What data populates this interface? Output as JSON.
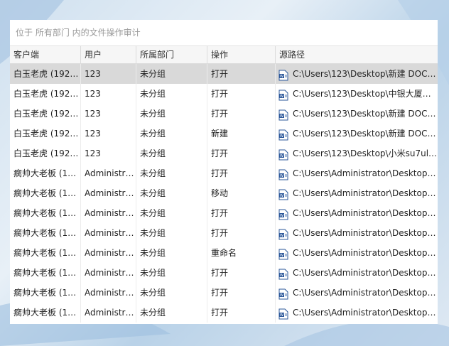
{
  "window": {
    "title": "位于 所有部门 内的文件操作审计"
  },
  "columns": [
    "客户端",
    "用户",
    "所属部门",
    "操作",
    "源路径"
  ],
  "icons": {
    "file": "word-document-icon"
  },
  "colors": {
    "selected_row": "#d9d9d9",
    "icon_blue": "#2b579a"
  },
  "rows": [
    {
      "client": "白玉老虎 (192.1...",
      "user": "123",
      "dept": "未分组",
      "op": "打开",
      "path": "C:\\Users\\123\\Desktop\\新建 DOC ...",
      "selected": true
    },
    {
      "client": "白玉老虎 (192.1...",
      "user": "123",
      "dept": "未分组",
      "op": "打开",
      "path": "C:\\Users\\123\\Desktop\\中银大厦设...",
      "selected": false
    },
    {
      "client": "白玉老虎 (192.1...",
      "user": "123",
      "dept": "未分组",
      "op": "打开",
      "path": "C:\\Users\\123\\Desktop\\新建 DOC ...",
      "selected": false
    },
    {
      "client": "白玉老虎 (192.1...",
      "user": "123",
      "dept": "未分组",
      "op": "新建",
      "path": "C:\\Users\\123\\Desktop\\新建 DOC ...",
      "selected": false
    },
    {
      "client": "白玉老虎 (192.1...",
      "user": "123",
      "dept": "未分组",
      "op": "打开",
      "path": "C:\\Users\\123\\Desktop\\小米su7ultr...",
      "selected": false
    },
    {
      "client": "瘸帅大老板 (19...",
      "user": "Administra...",
      "dept": "未分组",
      "op": "打开",
      "path": "C:\\Users\\Administrator\\Desktop\\...",
      "selected": false
    },
    {
      "client": "瘸帅大老板 (19...",
      "user": "Administra...",
      "dept": "未分组",
      "op": "移动",
      "path": "C:\\Users\\Administrator\\Desktop\\...",
      "selected": false
    },
    {
      "client": "瘸帅大老板 (19...",
      "user": "Administra...",
      "dept": "未分组",
      "op": "打开",
      "path": "C:\\Users\\Administrator\\Desktop\\...",
      "selected": false
    },
    {
      "client": "瘸帅大老板 (19...",
      "user": "Administra...",
      "dept": "未分组",
      "op": "打开",
      "path": "C:\\Users\\Administrator\\Desktop\\...",
      "selected": false
    },
    {
      "client": "瘸帅大老板 (19...",
      "user": "Administra...",
      "dept": "未分组",
      "op": "重命名",
      "path": "C:\\Users\\Administrator\\Desktop\\...",
      "selected": false
    },
    {
      "client": "瘸帅大老板 (19...",
      "user": "Administra...",
      "dept": "未分组",
      "op": "打开",
      "path": "C:\\Users\\Administrator\\Desktop\\...",
      "selected": false
    },
    {
      "client": "瘸帅大老板 (19...",
      "user": "Administra...",
      "dept": "未分组",
      "op": "打开",
      "path": "C:\\Users\\Administrator\\Desktop\\...",
      "selected": false
    },
    {
      "client": "瘸帅大老板 (19...",
      "user": "Administra...",
      "dept": "未分组",
      "op": "打开",
      "path": "C:\\Users\\Administrator\\Desktop\\...",
      "selected": false
    }
  ]
}
